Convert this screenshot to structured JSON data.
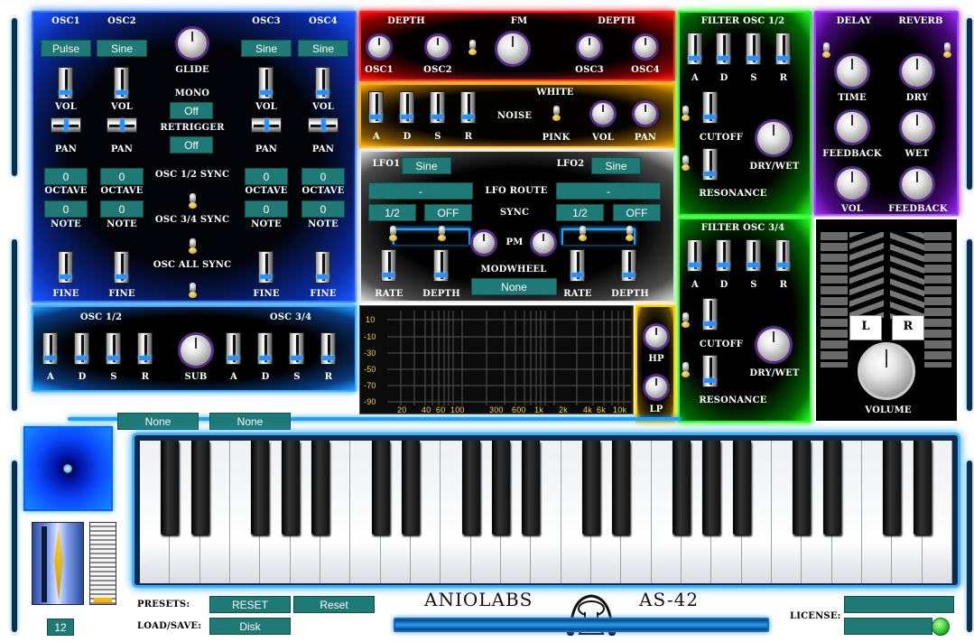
{
  "osc": {
    "headers": [
      "OSC1",
      "OSC2",
      "OSC3",
      "OSC4"
    ],
    "waves": [
      "Pulse",
      "Sine",
      "Sine",
      "Sine"
    ],
    "glide_label": "GLIDE",
    "mono_label": "MONO",
    "mono_value": "Off",
    "retrigger_label": "RETRIGGER",
    "retrigger_value": "Off",
    "vol_label": "VOL",
    "pan_label": "PAN",
    "octave_label": "OCTAVE",
    "note_label": "NOTE",
    "fine_label": "FINE",
    "octave_values": [
      "0",
      "0",
      "0",
      "0"
    ],
    "note_values": [
      "0",
      "0",
      "0",
      "0"
    ],
    "sync12": "OSC 1/2 SYNC",
    "sync34": "OSC 3/4 SYNC",
    "syncall": "OSC ALL SYNC"
  },
  "fm": {
    "depth_left": "DEPTH",
    "fm": "FM",
    "depth_right": "DEPTH",
    "labels": [
      "OSC1",
      "OSC2",
      "OSC3",
      "OSC4"
    ]
  },
  "noise": {
    "adsr": [
      "A",
      "D",
      "S",
      "R"
    ],
    "noise": "NOISE",
    "white": "WHITE",
    "pink": "PINK",
    "vol": "VOL",
    "pan": "PAN"
  },
  "lfo": {
    "lfo1": "LFO1",
    "lfo1_wave": "Sine",
    "lfo2": "LFO2",
    "lfo2_wave": "Sine",
    "route": "LFO ROUTE",
    "route1": "-",
    "route2": "-",
    "sync": "SYNC",
    "rate1": "1/2",
    "sync1": "OFF",
    "rate2": "1/2",
    "sync2": "OFF",
    "pm": "PM",
    "modwheel": "MODWHEEL",
    "modwheel_value": "None",
    "rate": "RATE",
    "depth": "DEPTH"
  },
  "filter1": {
    "title": "FILTER OSC 1/2",
    "adsr": [
      "A",
      "D",
      "S",
      "R"
    ],
    "cutoff": "CUTOFF",
    "resonance": "RESONANCE",
    "drywet": "DRY/WET"
  },
  "filter2": {
    "title": "FILTER OSC 3/4",
    "adsr": [
      "A",
      "D",
      "S",
      "R"
    ],
    "cutoff": "CUTOFF",
    "resonance": "RESONANCE",
    "drywet": "DRY/WET"
  },
  "fx": {
    "delay": "DELAY",
    "reverb": "REVERB",
    "time": "TIME",
    "dry": "DRY",
    "feedback": "FEEDBACK",
    "wet": "WET",
    "vol": "VOL",
    "feedback2": "FEEDBACK"
  },
  "env": {
    "osc12": "OSC 1/2",
    "osc34": "OSC 3/4",
    "adsr": [
      "A",
      "D",
      "S",
      "R"
    ],
    "sub": "SUB"
  },
  "eq": {
    "y_ticks": [
      "10",
      "-10",
      "-30",
      "-50",
      "-70",
      "-90"
    ],
    "x_ticks": [
      "20",
      "40",
      "60",
      "100",
      "300",
      "600",
      "1k",
      "2k",
      "4k",
      "6k",
      "10k"
    ],
    "hp": "HP",
    "lp": "LP"
  },
  "master": {
    "l": "L",
    "r": "R",
    "volume": "VOLUME"
  },
  "keyboard": {
    "select1": "None",
    "select2": "None",
    "pitch_value": "12"
  },
  "footer": {
    "presets": "PRESETS:",
    "reset1": "RESET",
    "reset2": "Reset",
    "loadsave": "LOAD/SAVE:",
    "disk": "Disk",
    "brand": "ANIOLABS",
    "model": "AS-42",
    "license": "LICENSE:"
  },
  "colors": {
    "osc_panel": "#0a3cff",
    "fm_panel": "#e00000",
    "noise_panel": "#f0a000",
    "filter_panel": "#00c800",
    "fx_panel": "#8a1ed8",
    "accent": "#1f7a76"
  }
}
